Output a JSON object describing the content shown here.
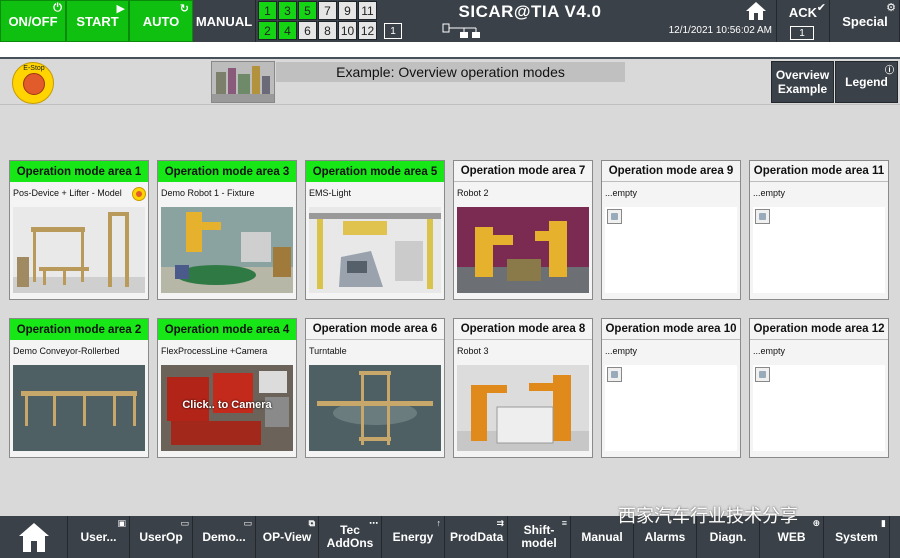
{
  "topbar": {
    "on_off": "ON/OFF",
    "start": "START",
    "auto": "AUTO",
    "manual": "MANUAL",
    "mode_cells": [
      {
        "label": "1",
        "active": true
      },
      {
        "label": "3",
        "active": true
      },
      {
        "label": "5",
        "active": true
      },
      {
        "label": "7",
        "active": false
      },
      {
        "label": "9",
        "active": false
      },
      {
        "label": "11",
        "active": false
      },
      {
        "label": "2",
        "active": true
      },
      {
        "label": "4",
        "active": true
      },
      {
        "label": "6",
        "active": false
      },
      {
        "label": "8",
        "active": false
      },
      {
        "label": "10",
        "active": false
      },
      {
        "label": "12",
        "active": false
      }
    ],
    "screen_number": "1",
    "title": "SICAR@TIA V4.0",
    "datetime": "12/1/2021 10:56:02 AM",
    "ack": "ACK",
    "ack_count": "1",
    "special": "Special"
  },
  "header": {
    "estop_label": "E-Stop",
    "page_title": "Example: Overview operation modes",
    "overview_example": "Overview Example",
    "legend": "Legend"
  },
  "areas": [
    {
      "title": "Operation mode area 1",
      "desc": "Pos-Device + Lifter - Model",
      "active": true,
      "image": "lifter"
    },
    {
      "title": "Operation mode area 3",
      "desc": "Demo Robot 1 - Fixture",
      "active": true,
      "image": "robot-fixture"
    },
    {
      "title": "Operation mode area 5",
      "desc": "EMS-Light",
      "active": true,
      "image": "ems"
    },
    {
      "title": "Operation mode area 7",
      "desc": "Robot 2",
      "active": false,
      "image": "robot2"
    },
    {
      "title": "Operation mode area 9",
      "desc": "...empty",
      "active": false,
      "image": "empty"
    },
    {
      "title": "Operation mode area 11",
      "desc": "...empty",
      "active": false,
      "image": "empty"
    },
    {
      "title": "Operation mode area 2",
      "desc": "Demo Conveyor-Rollerbed",
      "active": true,
      "image": "conveyor"
    },
    {
      "title": "Operation mode area 4",
      "desc": "FlexProcessLine +Camera",
      "active": true,
      "image": "flex",
      "overlay": "Click.. to Camera"
    },
    {
      "title": "Operation mode area 6",
      "desc": "Turntable",
      "active": false,
      "image": "turntable"
    },
    {
      "title": "Operation mode area 8",
      "desc": "Robot 3",
      "active": false,
      "image": "robot3"
    },
    {
      "title": "Operation mode area 10",
      "desc": "...empty",
      "active": false,
      "image": "empty"
    },
    {
      "title": "Operation mode area 12",
      "desc": "...empty",
      "active": false,
      "image": "empty"
    }
  ],
  "bottombar": {
    "buttons": [
      {
        "label": "User..."
      },
      {
        "label": "UserOp"
      },
      {
        "label": "Demo..."
      },
      {
        "label": "OP-View"
      },
      {
        "label": "Tec AddOns"
      },
      {
        "label": "Energy"
      },
      {
        "label": "ProdData"
      },
      {
        "label": "Shift-model"
      },
      {
        "label": "Manual"
      },
      {
        "label": "Alarms"
      },
      {
        "label": "Diagn."
      },
      {
        "label": "WEB"
      },
      {
        "label": "System"
      }
    ]
  },
  "watermark": "西家汽车行业技术分享",
  "colors": {
    "active_green": "#17e617",
    "bar_dark": "#3a4148",
    "estop_yellow": "#ffd400"
  }
}
